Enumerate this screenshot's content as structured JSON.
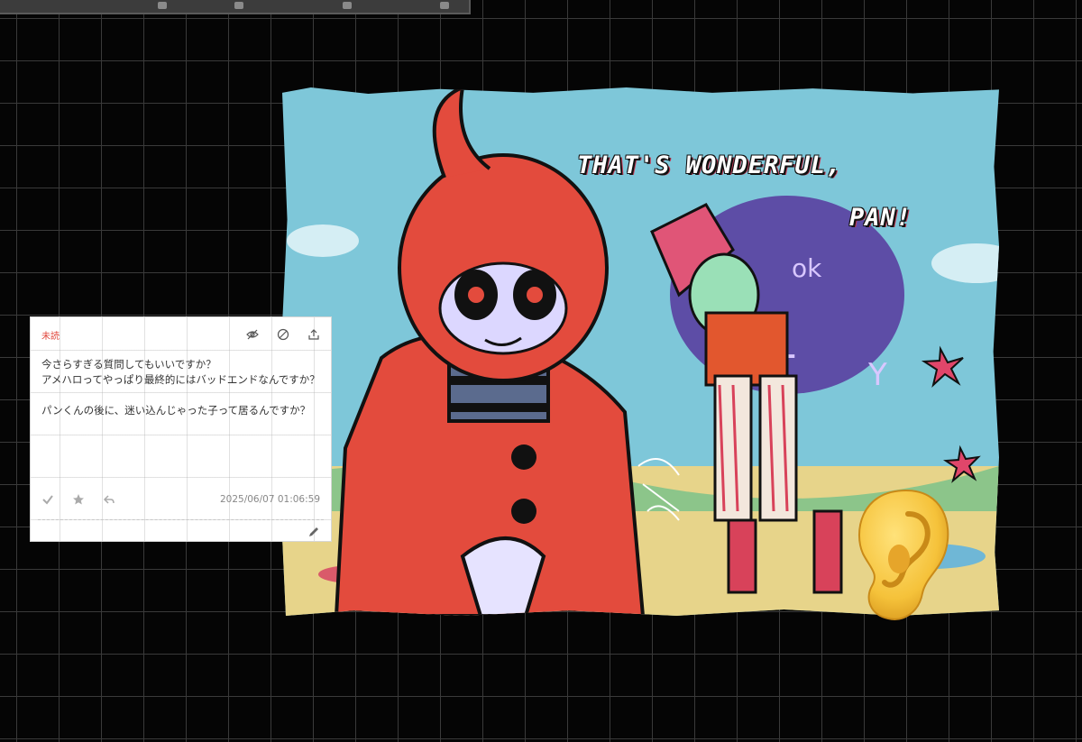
{
  "artwork": {
    "title_line1": "THAT'S WONDERFUL,",
    "title_line2": "PAN!",
    "colors": {
      "sky": "#7ec7d9",
      "ground": "#e7d48a",
      "red": "#e34b3d",
      "purple": "#5a3fa0"
    }
  },
  "card": {
    "status": "未読",
    "question": "今さらすぎる質問してもいいですか？\nアメハロってやっぱり最終的にはバッドエンドなんですか？\n\nパンくんの後に、迷い込んじゃった子って居るんですか？",
    "timestamp": "2025/06/07 01:06:59",
    "top_actions": [
      "eye-off-icon",
      "block-icon",
      "share-icon"
    ],
    "footer_actions": [
      "check-icon",
      "star-icon",
      "reply-icon"
    ],
    "accent": "#e0463b"
  }
}
